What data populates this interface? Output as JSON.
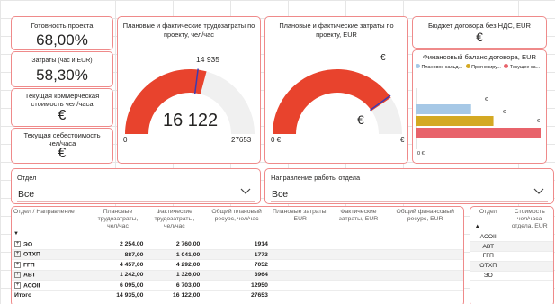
{
  "kpis": {
    "readiness": {
      "title": "Готовность проекта",
      "value": "68,00%"
    },
    "costs_share": {
      "title": "Затраты (час и EUR)",
      "value": "58,30%"
    },
    "commercial_cost": {
      "title": "Текущая коммерческая стоимость чел/часа",
      "value": "€"
    },
    "self_cost": {
      "title": "Текущая себестоимость чел/часа",
      "value": "€"
    }
  },
  "gauge_hours": {
    "title": "Плановые и фактические трудозатраты по проекту, чел/час",
    "value": "16 122",
    "target_label": "14 935",
    "min_label": "0",
    "max_label": "27653",
    "min": 0,
    "max": 27653,
    "actual": 16122,
    "target": 14935,
    "fill_color": "#e8432d",
    "track_color": "#f0f0f0",
    "target_color": "#3b3bb3"
  },
  "gauge_eur": {
    "title": "Плановые и фактические затраты по проекту, EUR",
    "value": "€",
    "target_label": "€",
    "min_label": "0 €",
    "max_label": "€",
    "actual_fraction": 0.81,
    "target_fraction": 0.8,
    "fill_color": "#e8432d",
    "track_color": "#f0f0f0",
    "target_color": "#3b3bb3"
  },
  "budget": {
    "title": "Бюджет договора без НДС, EUR",
    "value": "€"
  },
  "balance_chart": {
    "title": "Финансовый баланс договора, EUR",
    "legend": [
      {
        "label": "Плановое сальд...",
        "color": "#a6c8e6"
      },
      {
        "label": "Прогнозиру...",
        "color": "#d4a923"
      },
      {
        "label": "Текущее са...",
        "color": "#e8636b"
      }
    ],
    "bar_labels": [
      "€",
      "€",
      "€"
    ],
    "axis_label": "0 €"
  },
  "chart_data": {
    "type": "bar",
    "title": "Финансовый баланс договора, EUR",
    "orientation": "horizontal",
    "series": [
      {
        "name": "Плановое сальд...",
        "values": [
          0.44
        ]
      },
      {
        "name": "Прогнозиру...",
        "values": [
          0.62
        ]
      },
      {
        "name": "Текущее са...",
        "values": [
          1.0
        ]
      }
    ]
  },
  "slicers": {
    "department": {
      "title": "Отдел",
      "value": "Все"
    },
    "direction": {
      "title": "Направление работы отдела",
      "value": "Все"
    }
  },
  "main_table": {
    "headers": [
      "Отдел / Направление",
      "Плановые трудозатраты, чел/час",
      "Фактические трудозатраты, чел/час",
      "Общий плановый ресурс, чел/час",
      "Плановые затраты, EUR",
      "Фактические затраты, EUR",
      "Общий финансовый ресурс, EUR"
    ],
    "rows": [
      {
        "name": "ЭО",
        "plan_hours": "2 254,00",
        "fact_hours": "2 760,00",
        "total_hours": "1914",
        "plan_eur": "",
        "fact_eur": "",
        "total_eur": ""
      },
      {
        "name": "ОТХП",
        "plan_hours": "887,00",
        "fact_hours": "1 041,00",
        "total_hours": "1773",
        "plan_eur": "",
        "fact_eur": "",
        "total_eur": ""
      },
      {
        "name": "ГГП",
        "plan_hours": "4 457,00",
        "fact_hours": "4 292,00",
        "total_hours": "7052",
        "plan_eur": "",
        "fact_eur": "",
        "total_eur": ""
      },
      {
        "name": "АВТ",
        "plan_hours": "1 242,00",
        "fact_hours": "1 326,00",
        "total_hours": "3964",
        "plan_eur": "",
        "fact_eur": "",
        "total_eur": ""
      },
      {
        "name": "АСОII",
        "plan_hours": "6 095,00",
        "fact_hours": "6 703,00",
        "total_hours": "12950",
        "plan_eur": "",
        "fact_eur": "",
        "total_eur": ""
      }
    ],
    "total": {
      "name": "Итого",
      "plan_hours": "14 935,00",
      "fact_hours": "16 122,00",
      "total_hours": "27653",
      "plan_eur": "",
      "fact_eur": "",
      "total_eur": ""
    }
  },
  "side_table": {
    "headers": [
      "Отдел",
      "Стоимость чел/часа отдела, EUR"
    ],
    "rows": [
      {
        "name": "АСОII",
        "cost": ""
      },
      {
        "name": "АВТ",
        "cost": ""
      },
      {
        "name": "ГГП",
        "cost": ""
      },
      {
        "name": "ОТХП",
        "cost": ""
      },
      {
        "name": "ЭО",
        "cost": ""
      }
    ]
  },
  "colors": {
    "card_border": "#ef8a8a",
    "accent_red": "#e8432d"
  },
  "icons": {
    "expand": "plus-box-icon",
    "chevron": "chevron-down-icon",
    "sort": "sort-ascending-icon"
  }
}
